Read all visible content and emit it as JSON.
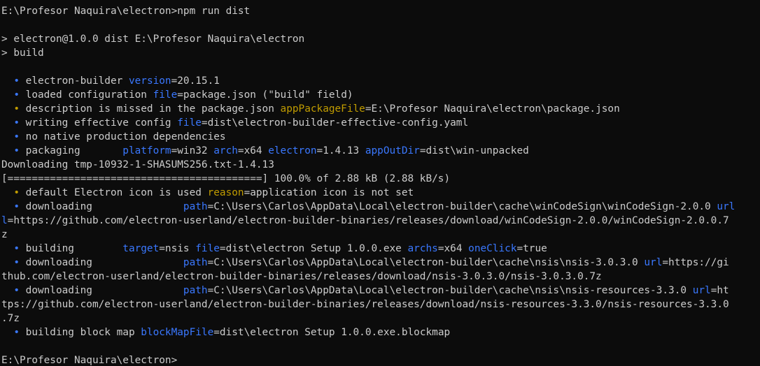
{
  "terminal": {
    "lines": [
      [
        {
          "t": "E:\\Profesor Naquira\\electron>npm run dist",
          "c": "plain"
        }
      ],
      [],
      [
        {
          "t": "> electron@1.0.0 dist E:\\Profesor Naquira\\electron",
          "c": "plain"
        }
      ],
      [
        {
          "t": "> build",
          "c": "plain"
        }
      ],
      [],
      [
        {
          "t": "  • ",
          "c": "bullet-blue"
        },
        {
          "t": "electron-builder ",
          "c": "plain"
        },
        {
          "t": "version",
          "c": "key-blue"
        },
        {
          "t": "=20.15.1",
          "c": "plain"
        }
      ],
      [
        {
          "t": "  • ",
          "c": "bullet-blue"
        },
        {
          "t": "loaded configuration ",
          "c": "plain"
        },
        {
          "t": "file",
          "c": "key-blue"
        },
        {
          "t": "=package.json (\"build\" field)",
          "c": "plain"
        }
      ],
      [
        {
          "t": "  • ",
          "c": "bullet-yellow"
        },
        {
          "t": "description is missed in the package.json ",
          "c": "plain"
        },
        {
          "t": "appPackageFile",
          "c": "key-yellow"
        },
        {
          "t": "=E:\\Profesor Naquira\\electron\\package.json",
          "c": "plain"
        }
      ],
      [
        {
          "t": "  • ",
          "c": "bullet-blue"
        },
        {
          "t": "writing effective config ",
          "c": "plain"
        },
        {
          "t": "file",
          "c": "key-blue"
        },
        {
          "t": "=dist\\electron-builder-effective-config.yaml",
          "c": "plain"
        }
      ],
      [
        {
          "t": "  • ",
          "c": "bullet-blue"
        },
        {
          "t": "no native production dependencies",
          "c": "plain"
        }
      ],
      [
        {
          "t": "  • ",
          "c": "bullet-blue"
        },
        {
          "t": "packaging       ",
          "c": "plain"
        },
        {
          "t": "platform",
          "c": "key-blue"
        },
        {
          "t": "=win32 ",
          "c": "plain"
        },
        {
          "t": "arch",
          "c": "key-blue"
        },
        {
          "t": "=x64 ",
          "c": "plain"
        },
        {
          "t": "electron",
          "c": "key-blue"
        },
        {
          "t": "=1.4.13 ",
          "c": "plain"
        },
        {
          "t": "appOutDir",
          "c": "key-blue"
        },
        {
          "t": "=dist\\win-unpacked",
          "c": "plain"
        }
      ],
      [
        {
          "t": "Downloading tmp-10932-1-SHASUMS256.txt-1.4.13",
          "c": "plain"
        }
      ],
      [
        {
          "t": "[==========================================] 100.0% of 2.88 kB (2.88 kB/s)",
          "c": "plain"
        }
      ],
      [
        {
          "t": "  • ",
          "c": "bullet-yellow"
        },
        {
          "t": "default Electron icon is used ",
          "c": "plain"
        },
        {
          "t": "reason",
          "c": "key-yellow"
        },
        {
          "t": "=application icon is not set",
          "c": "plain"
        }
      ],
      [
        {
          "t": "  • ",
          "c": "bullet-blue"
        },
        {
          "t": "downloading               ",
          "c": "plain"
        },
        {
          "t": "path",
          "c": "key-blue"
        },
        {
          "t": "=C:\\Users\\Carlos\\AppData\\Local\\electron-builder\\cache\\winCodeSign\\winCodeSign-2.0.0 ",
          "c": "plain"
        },
        {
          "t": "url",
          "c": "key-blue"
        }
      ],
      [
        {
          "t": "l",
          "c": "key-blue"
        },
        {
          "t": "=https://github.com/electron-userland/electron-builder-binaries/releases/download/winCodeSign-2.0.0/winCodeSign-2.0.0.7",
          "c": "plain"
        }
      ],
      [
        {
          "t": "z",
          "c": "plain"
        }
      ],
      [
        {
          "t": "  • ",
          "c": "bullet-blue"
        },
        {
          "t": "building        ",
          "c": "plain"
        },
        {
          "t": "target",
          "c": "key-blue"
        },
        {
          "t": "=nsis ",
          "c": "plain"
        },
        {
          "t": "file",
          "c": "key-blue"
        },
        {
          "t": "=dist\\electron Setup 1.0.0.exe ",
          "c": "plain"
        },
        {
          "t": "archs",
          "c": "key-blue"
        },
        {
          "t": "=x64 ",
          "c": "plain"
        },
        {
          "t": "oneClick",
          "c": "key-blue"
        },
        {
          "t": "=true",
          "c": "plain"
        }
      ],
      [
        {
          "t": "  • ",
          "c": "bullet-blue"
        },
        {
          "t": "downloading               ",
          "c": "plain"
        },
        {
          "t": "path",
          "c": "key-blue"
        },
        {
          "t": "=C:\\Users\\Carlos\\AppData\\Local\\electron-builder\\cache\\nsis\\nsis-3.0.3.0 ",
          "c": "plain"
        },
        {
          "t": "url",
          "c": "key-blue"
        },
        {
          "t": "=https://gi",
          "c": "plain"
        }
      ],
      [
        {
          "t": "thub.com/electron-userland/electron-builder-binaries/releases/download/nsis-3.0.3.0/nsis-3.0.3.0.7z",
          "c": "plain"
        }
      ],
      [
        {
          "t": "  • ",
          "c": "bullet-blue"
        },
        {
          "t": "downloading               ",
          "c": "plain"
        },
        {
          "t": "path",
          "c": "key-blue"
        },
        {
          "t": "=C:\\Users\\Carlos\\AppData\\Local\\electron-builder\\cache\\nsis\\nsis-resources-3.3.0 ",
          "c": "plain"
        },
        {
          "t": "url",
          "c": "key-blue"
        },
        {
          "t": "=ht",
          "c": "plain"
        }
      ],
      [
        {
          "t": "tps://github.com/electron-userland/electron-builder-binaries/releases/download/nsis-resources-3.3.0/nsis-resources-3.3.0",
          "c": "plain"
        }
      ],
      [
        {
          "t": ".7z",
          "c": "plain"
        }
      ],
      [
        {
          "t": "  • ",
          "c": "bullet-blue"
        },
        {
          "t": "building block map ",
          "c": "plain"
        },
        {
          "t": "blockMapFile",
          "c": "key-blue"
        },
        {
          "t": "=dist\\electron Setup 1.0.0.exe.blockmap",
          "c": "plain"
        }
      ],
      [],
      [
        {
          "t": "E:\\Profesor Naquira\\electron>",
          "c": "plain"
        }
      ]
    ]
  }
}
